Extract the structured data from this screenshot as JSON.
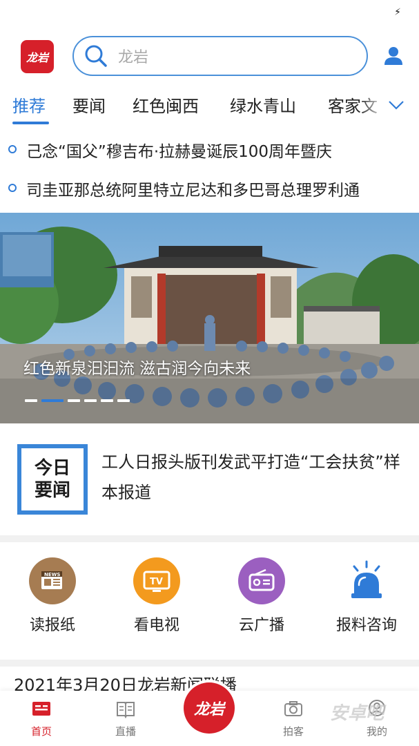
{
  "app": {
    "logo_text": "龙岩",
    "colors": {
      "brand_red": "#d6202a",
      "accent_blue": "#2f7bd7"
    }
  },
  "status_bar": {
    "charging_icon": "lightning-icon",
    "glyph": "⚡"
  },
  "search": {
    "placeholder": "龙岩",
    "icon": "search-icon"
  },
  "header": {
    "user_icon": "user-icon"
  },
  "tabs": [
    {
      "label": "推荐",
      "active": true
    },
    {
      "label": "要闻",
      "active": false
    },
    {
      "label": "红色闽西",
      "active": false
    },
    {
      "label": "绿水青山",
      "active": false
    },
    {
      "label": "客家文",
      "active": false
    }
  ],
  "ticker": [
    {
      "text": "己念“国父”穆吉布·拉赫曼诞辰100周年暨庆"
    },
    {
      "text": "司圭亚那总统阿里特立尼达和多巴哥总理罗利通"
    }
  ],
  "banner": {
    "caption": "红色新泉汩汩流  滋古润今向未来",
    "slide_count": 6,
    "active_slide": 2
  },
  "today_news": {
    "badge_line1": "今日",
    "badge_line2": "要闻",
    "headline": "工人日报头版刊发武平打造“工会扶贫”样本报道"
  },
  "services": [
    {
      "label": "读报纸",
      "icon": "newspaper-icon",
      "color": "#a67c52"
    },
    {
      "label": "看电视",
      "icon": "tv-icon",
      "color": "#f39a1e"
    },
    {
      "label": "云广播",
      "icon": "radio-icon",
      "color": "#9b5fc0"
    },
    {
      "label": "报料咨询",
      "icon": "alarm-light-icon",
      "color": "#2f7bd7"
    }
  ],
  "feed_peek": {
    "text": "2021年3月20日龙岩新闻联播"
  },
  "bottom_nav": [
    {
      "label": "首页",
      "icon": "home-news-icon",
      "active": true
    },
    {
      "label": "直播",
      "icon": "book-icon",
      "active": false
    },
    {
      "label": "龙岩",
      "icon": "logo-center-button",
      "active": false
    },
    {
      "label": "拍客",
      "icon": "camera-icon",
      "active": false
    },
    {
      "label": "我的",
      "icon": "profile-icon",
      "active": false
    }
  ],
  "watermark": "安卓吧"
}
